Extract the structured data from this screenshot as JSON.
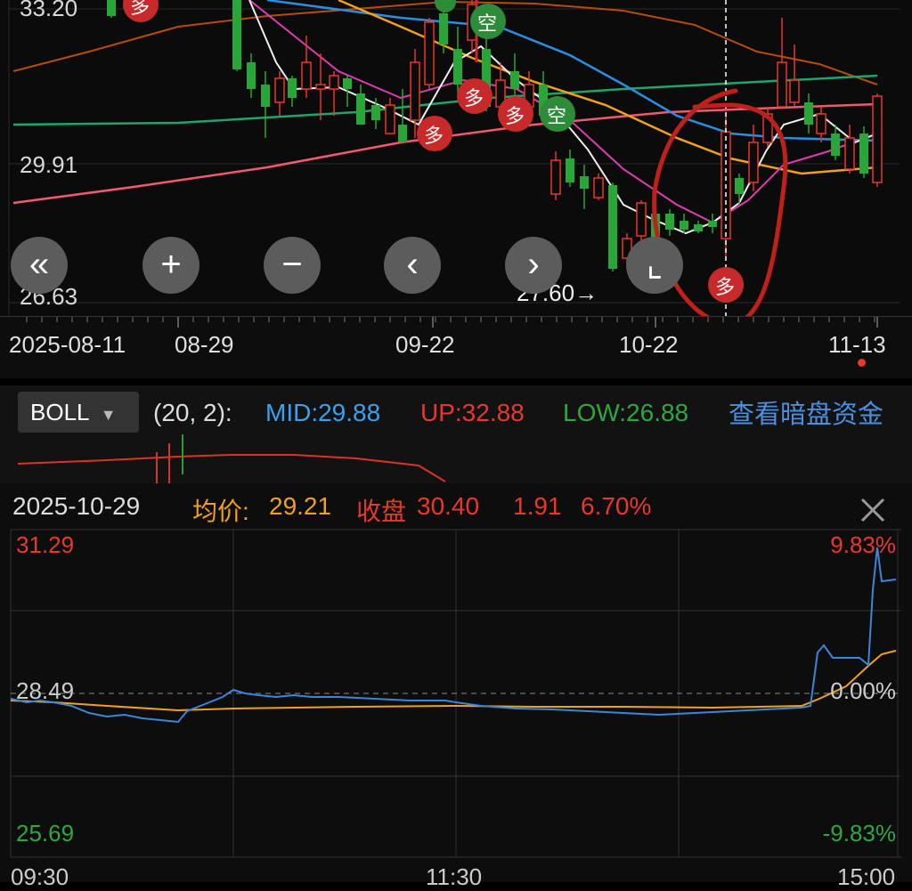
{
  "kline": {
    "y_labels": {
      "top": "33.20",
      "mid": "29.91",
      "low": "26.63"
    },
    "low_marker": "27.60→",
    "signals": {
      "buy": "多",
      "sell": "空"
    },
    "controls": {
      "rewind": "«",
      "zoom_in": "+",
      "zoom_out": "−",
      "prev": "‹",
      "next": "›",
      "fullscreen": "⌞"
    },
    "dates": [
      "2025-08-11",
      "08-29",
      "09-22",
      "10-22",
      "11-13"
    ],
    "colors": {
      "up": "#e8382b",
      "down": "#29a638",
      "annotation": "#c0201a"
    }
  },
  "boll": {
    "indicator": "BOLL",
    "params": "(20, 2):",
    "mid": "MID:29.88",
    "up": "UP:32.88",
    "low": "LOW:26.88",
    "link": "查看暗盘资金"
  },
  "intraday": {
    "date": "2025-10-29",
    "avg_label": "均价:",
    "avg_value": "29.21",
    "close_label": "收盘",
    "close_value": "30.40",
    "change": "1.91",
    "change_pct": "6.70%",
    "price_high": "31.29",
    "price_ref": "28.49",
    "price_low": "25.69",
    "pct_high": "9.83%",
    "pct_ref": "0.00%",
    "pct_low": "-9.83%",
    "times": [
      "09:30",
      "11:30",
      "15:00"
    ]
  }
}
